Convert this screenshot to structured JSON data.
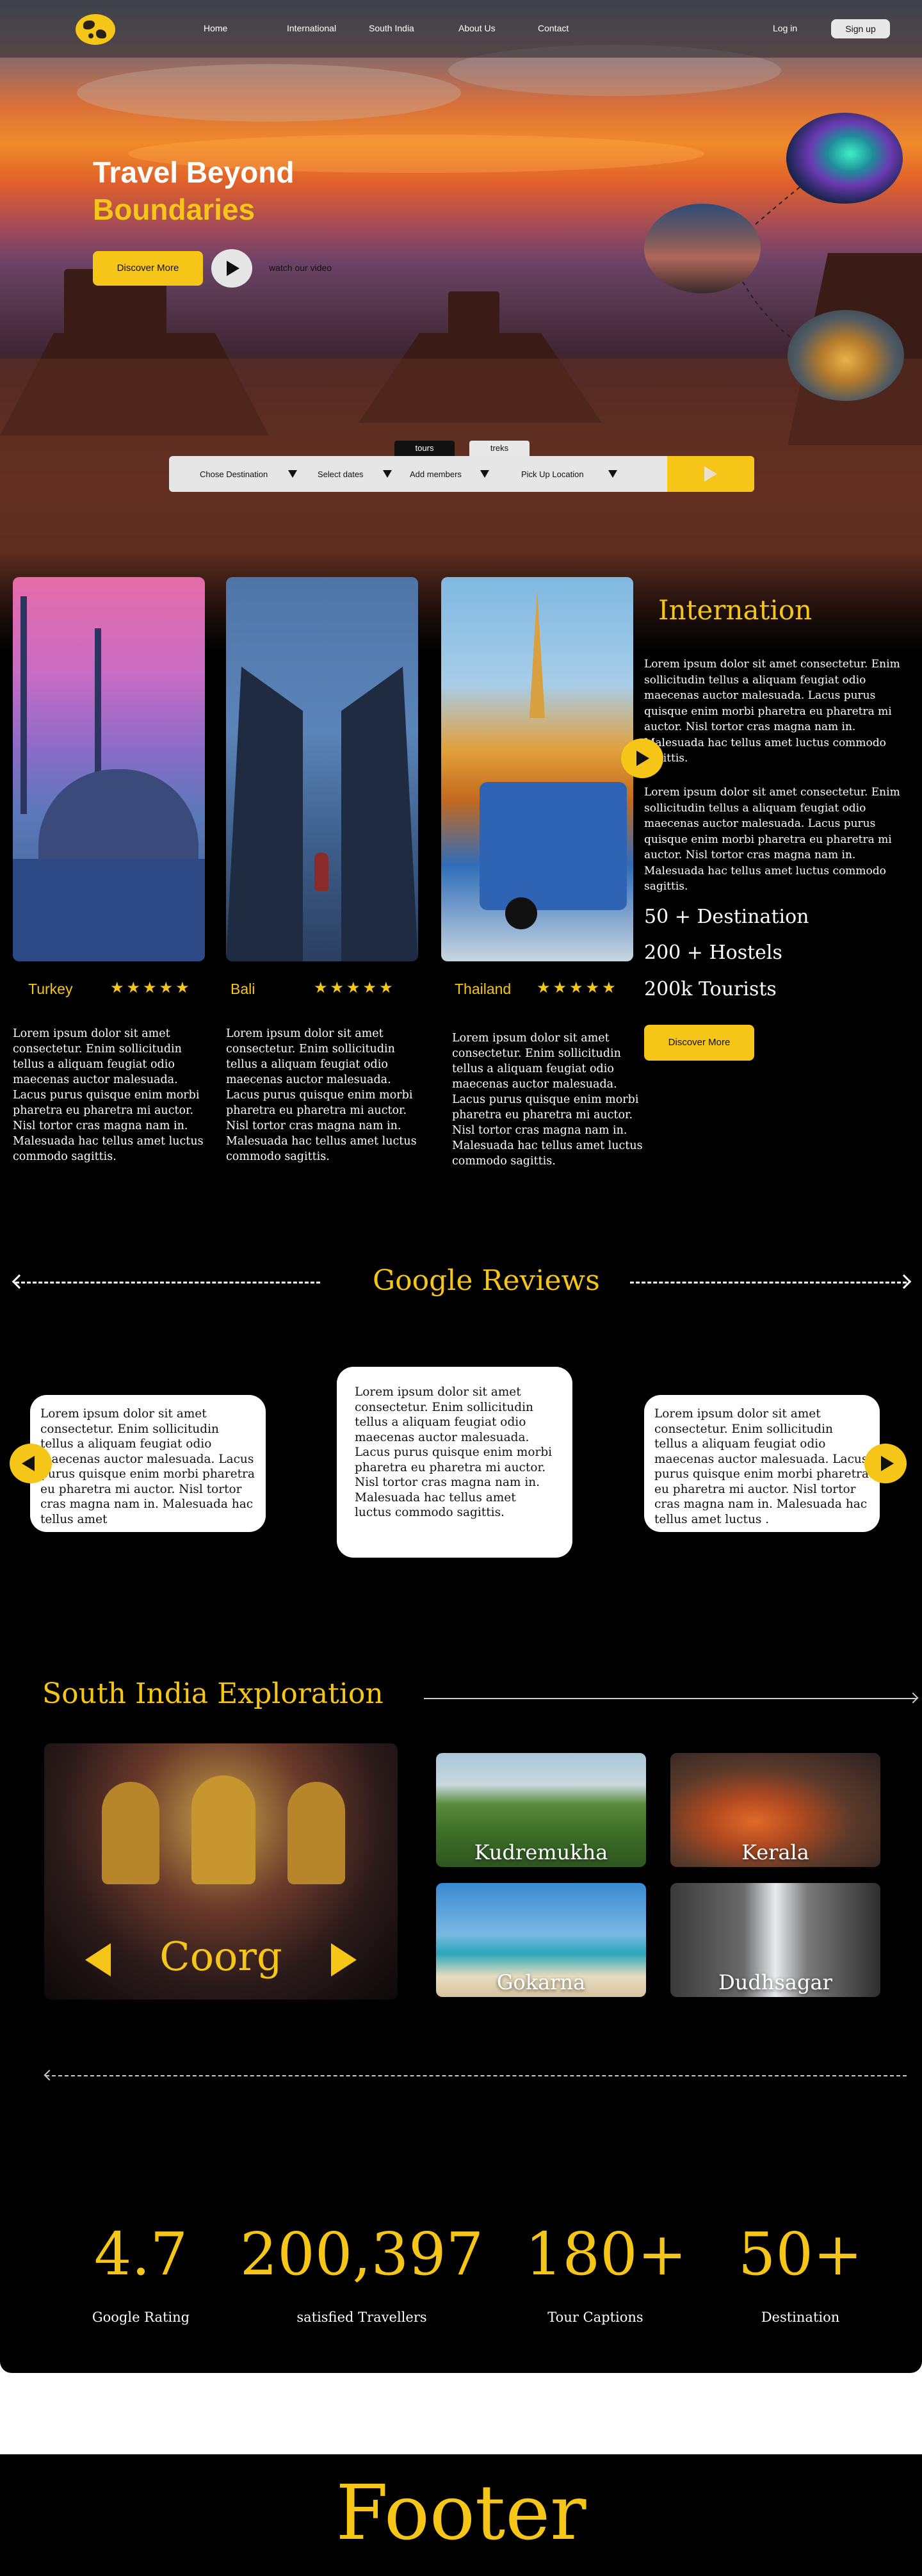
{
  "nav": {
    "links": [
      "Home",
      "International",
      "South India",
      "About Us",
      "Contact"
    ],
    "login": "Log in",
    "signup": "Sign up"
  },
  "hero": {
    "title_1": "Travel Beyond",
    "title_2": "Boundaries",
    "discover": "Discover More",
    "watch": "watch our video"
  },
  "search": {
    "tabs": [
      "tours",
      "treks"
    ],
    "fields": [
      "Chose Destination",
      "Select dates",
      "Add members",
      "Pick Up Location"
    ]
  },
  "destinations": [
    {
      "name": "Turkey",
      "stars": "★★★★★",
      "rating": 5,
      "desc": "Lorem ipsum dolor sit amet consectetur. Enim sollicitudin tellus a aliquam feugiat odio maecenas auctor malesuada. Lacus purus quisque enim morbi pharetra eu pharetra mi auctor. Nisl tortor cras magna nam in. Malesuada hac tellus amet luctus commodo sagittis."
    },
    {
      "name": "Bali",
      "stars": "★★★★★",
      "rating": 5,
      "desc": "Lorem ipsum dolor sit amet consectetur. Enim sollicitudin tellus a aliquam feugiat odio maecenas auctor malesuada. Lacus purus quisque enim morbi pharetra eu pharetra mi auctor. Nisl tortor cras magna nam in. Malesuada hac tellus amet luctus commodo sagittis."
    },
    {
      "name": "Thailand",
      "stars": "★★★★★",
      "rating": 5,
      "desc": "Lorem ipsum dolor sit amet consectetur. Enim sollicitudin tellus a aliquam feugiat odio maecenas auctor malesuada. Lacus purus quisque enim morbi pharetra eu pharetra mi auctor. Nisl tortor cras magna nam in. Malesuada hac tellus amet luctus commodo sagittis."
    }
  ],
  "international": {
    "title": "Internation",
    "p1": "Lorem ipsum dolor sit amet consectetur. Enim sollicitudin tellus a aliquam feugiat odio maecenas auctor malesuada. Lacus purus quisque enim morbi pharetra eu pharetra mi auctor. Nisl tortor cras magna nam in. Malesuada hac tellus amet luctus commodo sagittis.",
    "p2": "Lorem ipsum dolor sit amet consectetur. Enim sollicitudin tellus a aliquam feugiat odio maecenas auctor malesuada. Lacus purus quisque enim morbi pharetra eu pharetra mi auctor. Nisl tortor cras magna nam in. Malesuada hac tellus amet luctus commodo sagittis.",
    "stats": [
      "50 + Destination",
      "200 + Hostels",
      "200k Tourists"
    ],
    "discover": "Discover More"
  },
  "reviews": {
    "title": "Google Reviews",
    "items": [
      "Lorem ipsum dolor sit amet consectetur. Enim sollicitudin tellus a aliquam feugiat odio maecenas auctor malesuada. Lacus purus quisque enim morbi pharetra eu pharetra mi auctor. Nisl tortor cras magna nam in. Malesuada hac tellus amet",
      "Lorem ipsum dolor sit amet consectetur. Enim sollicitudin tellus a aliquam feugiat odio maecenas auctor malesuada. Lacus purus quisque enim morbi pharetra eu pharetra mi auctor. Nisl tortor cras magna nam in. Malesuada hac tellus amet luctus commodo sagittis.",
      "Lorem ipsum dolor sit amet consectetur. Enim sollicitudin tellus a aliquam feugiat odio maecenas auctor malesuada. Lacus purus quisque enim morbi pharetra eu pharetra mi auctor. Nisl tortor cras magna nam in. Malesuada hac tellus amet luctus ."
    ]
  },
  "south_india": {
    "title": "South India Exploration",
    "featured": "Coorg",
    "spots": [
      "Kudremukha",
      "Kerala",
      "Gokarna",
      "Dudhsagar"
    ]
  },
  "counters": [
    {
      "value": "4.7",
      "label": "Google Rating"
    },
    {
      "value": "200,397",
      "label": "satisfied Travellers"
    },
    {
      "value": "180+",
      "label": "Tour Captions"
    },
    {
      "value": "50+",
      "label": "Destination"
    }
  ],
  "footer": {
    "text": "Footer"
  },
  "colors": {
    "accent": "#F5C518",
    "background": "#000000",
    "card": "#FFFFFF"
  }
}
